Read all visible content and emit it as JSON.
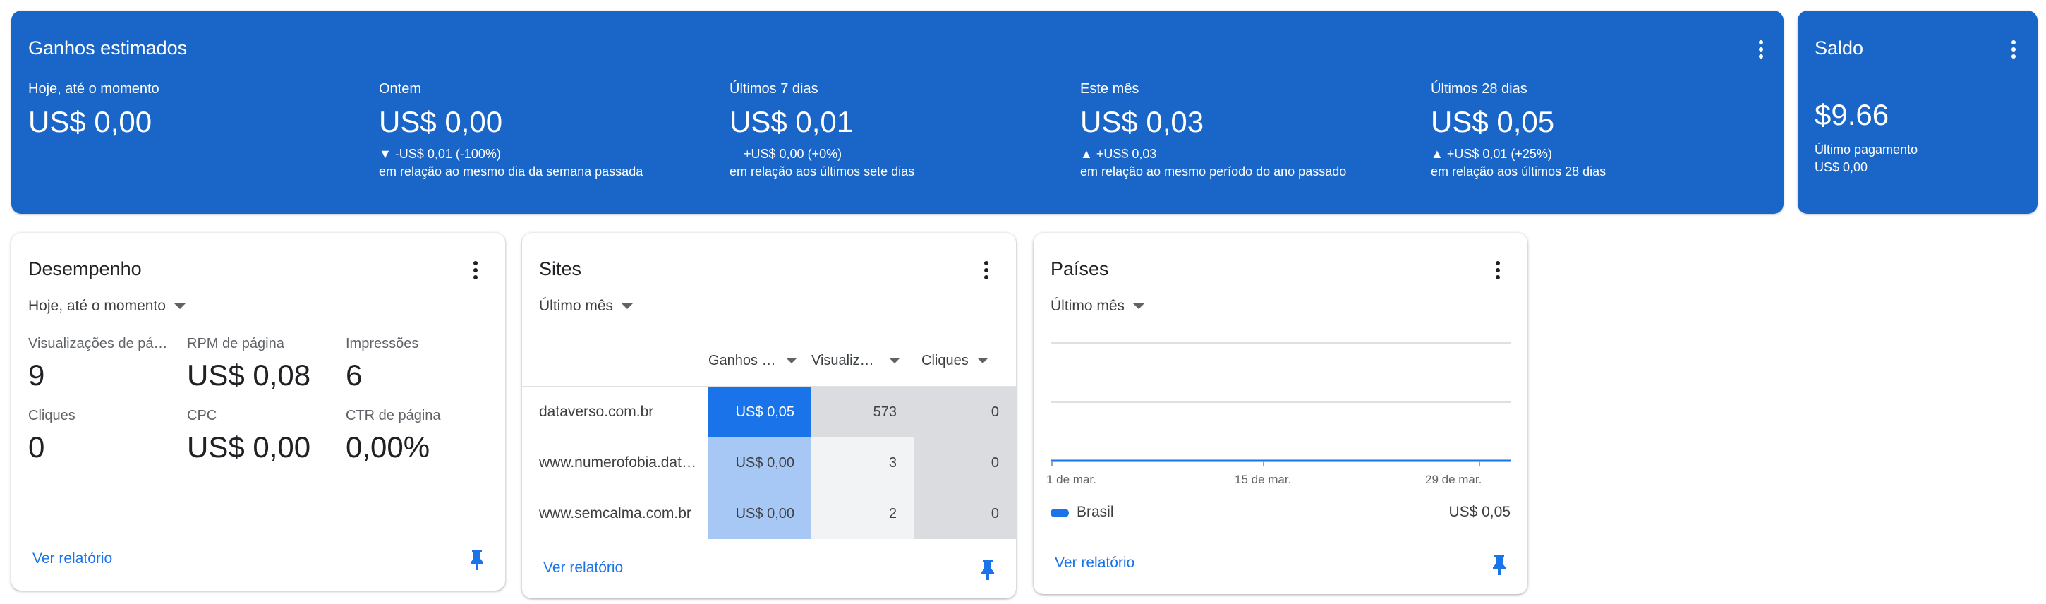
{
  "earnings": {
    "title": "Ganhos estimados",
    "metrics": [
      {
        "label": "Hoje, até o momento",
        "value": "US$ 0,00",
        "delta": "",
        "note": ""
      },
      {
        "label": "Ontem",
        "value": "US$ 0,00",
        "delta": "▼ -US$ 0,01 (-100%)",
        "note": "em relação ao mesmo dia da semana passada"
      },
      {
        "label": "Últimos 7 dias",
        "value": "US$ 0,01",
        "delta": "+US$ 0,00 (+0%)",
        "note": "em relação aos últimos sete dias"
      },
      {
        "label": "Este mês",
        "value": "US$ 0,03",
        "delta": "▲ +US$ 0,03",
        "note": "em relação ao mesmo período do ano passado"
      },
      {
        "label": "Últimos 28 dias",
        "value": "US$ 0,05",
        "delta": "▲ +US$ 0,01 (+25%)",
        "note": "em relação aos últimos 28 dias"
      }
    ]
  },
  "balance": {
    "title": "Saldo",
    "value": "$9.66",
    "last_payment_label": "Último pagamento",
    "last_payment_value": "US$ 0,00"
  },
  "performance": {
    "title": "Desempenho",
    "period": "Hoje, até o momento",
    "metrics": [
      {
        "label": "Visualizações de página",
        "value": "9"
      },
      {
        "label": "RPM de página",
        "value": "US$ 0,08"
      },
      {
        "label": "Impressões",
        "value": "6"
      },
      {
        "label": "Cliques",
        "value": "0"
      },
      {
        "label": "CPC",
        "value": "US$ 0,00"
      },
      {
        "label": "CTR de página",
        "value": "0,00%"
      }
    ],
    "report_link": "Ver relatório"
  },
  "sites": {
    "title": "Sites",
    "period": "Último mês",
    "columns": [
      "Ganhos estimados",
      "Visualizações de página",
      "Cliques"
    ],
    "rows": [
      {
        "site": "dataverso.com.br",
        "earnings": "US$ 0,05",
        "views": "573",
        "clicks": "0"
      },
      {
        "site": "www.numerofobia.dataverso.com.br",
        "earnings": "US$ 0,00",
        "views": "3",
        "clicks": "0"
      },
      {
        "site": "www.semcalma.com.br",
        "earnings": "US$ 0,00",
        "views": "2",
        "clicks": "0"
      }
    ],
    "report_link": "Ver relatório"
  },
  "countries": {
    "title": "Países",
    "period": "Último mês",
    "x_labels": [
      "1 de mar.",
      "15 de mar.",
      "29 de mar."
    ],
    "legend": [
      {
        "name": "Brasil",
        "value": "US$ 0,05",
        "color": "#1a73e8"
      }
    ],
    "report_link": "Ver relatório"
  },
  "colors": {
    "accent": "#1a66c8",
    "link": "#1a73e8"
  }
}
